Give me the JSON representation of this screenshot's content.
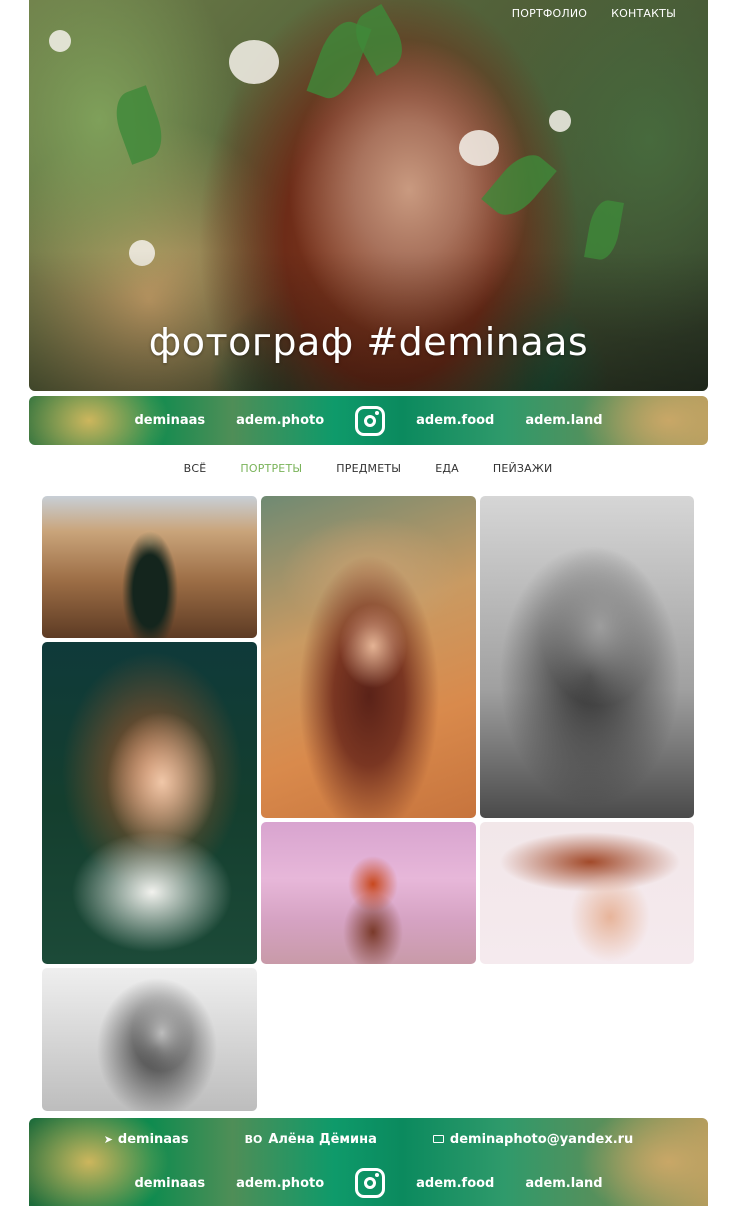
{
  "nav": {
    "portfolio": "ПОРТФОЛИО",
    "contacts": "КОНТАКТЫ"
  },
  "hero": {
    "title": "фотограф #deminaas"
  },
  "social": {
    "links": [
      "deminaas",
      "adem.photo",
      "adem.food",
      "adem.land"
    ],
    "icon": "instagram-icon"
  },
  "filters": {
    "items": [
      "ВСЁ",
      "ПОРТРЕТЫ",
      "ПРЕДМЕТЫ",
      "ЕДА",
      "ПЕЙЗАЖИ"
    ],
    "active": "ПОРТРЕТЫ",
    "active_color": "#7ab35a"
  },
  "footer": {
    "telegram": "deminaas",
    "vk": "Алёна Дёмина",
    "email": "deminaphoto@yandex.ru",
    "links": [
      "deminaas",
      "adem.photo",
      "adem.food",
      "adem.land"
    ]
  }
}
